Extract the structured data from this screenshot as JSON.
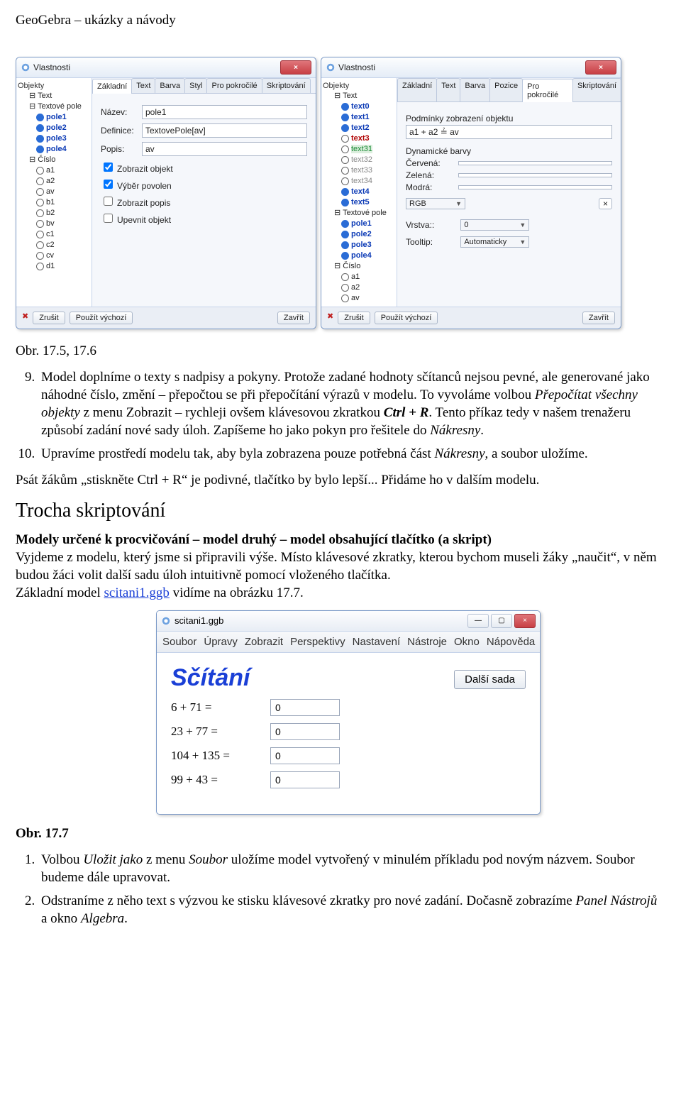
{
  "doc_header": "GeoGebra – ukázky a návody",
  "dlg_shared": {
    "title": "Vlastnosti",
    "close_x": "×",
    "tree_header": "Objekty",
    "bottom": {
      "cancel": "Zrušit",
      "defaults": "Použít výchozí",
      "close": "Zavřít"
    },
    "tabs": [
      "Základní",
      "Text",
      "Barva",
      "Styl",
      "Pro pokročilé",
      "Skriptování"
    ],
    "tabs2": [
      "Základní",
      "Text",
      "Barva",
      "Pozice",
      "Pro pokročilé",
      "Skriptování"
    ]
  },
  "dlg_left": {
    "tree": {
      "cat1": "Text",
      "cat2": "Textové pole",
      "cat2_items": [
        "pole1",
        "pole2",
        "pole3",
        "pole4"
      ],
      "cat3": "Číslo",
      "cat3_items": [
        "a1",
        "a2",
        "av",
        "b1",
        "b2",
        "bv",
        "c1",
        "c2",
        "cv",
        "d1"
      ]
    },
    "form": {
      "name_lbl": "Název:",
      "name_val": "pole1",
      "def_lbl": "Definice:",
      "def_val": "TextovePole[av]",
      "desc_lbl": "Popis:",
      "desc_val": "av",
      "chk_show": "Zobrazit objekt",
      "chk_sel": "Výběr povolen",
      "chk_lbl": "Zobrazit popis",
      "chk_fix": "Upevnit objekt"
    }
  },
  "dlg_right": {
    "tree": {
      "cat1": "Text",
      "cat1_items": [
        "text0",
        "text1",
        "text2",
        "text3",
        "text31",
        "text32",
        "text33",
        "text34",
        "text4",
        "text5"
      ],
      "cat2": "Textové pole",
      "cat2_items": [
        "pole1",
        "pole2",
        "pole3",
        "pole4"
      ],
      "cat3": "Číslo",
      "cat3_items": [
        "a1",
        "a2",
        "av"
      ]
    },
    "adv": {
      "cond_hd": "Podmínky zobrazení objektu",
      "cond_val": "a1 + a2 ≟ av",
      "dyncol_hd": "Dynamické barvy",
      "red": "Červená:",
      "green": "Zelená:",
      "blue": "Modrá:",
      "rgb": "RGB",
      "layer_lbl": "Vrstva::",
      "layer_val": "0",
      "tooltip_lbl": "Tooltip:",
      "tooltip_val": "Automaticky"
    }
  },
  "caption_figs": "Obr. 17.5, 17.6",
  "list1": {
    "item9_a": "Model doplníme o texty s nadpisy a pokyny. Protože zadané hodnoty sčítanců nejsou pevné, ale generované jako náhodné číslo, změní – přepočtou se při přepočítání výrazů v modelu. To vyvoláme volbou ",
    "item9_b": "Přepočítat všechny objekty",
    "item9_c": " z menu Zobrazit – rychleji ovšem klávesovou zkratkou ",
    "item9_d": "Ctrl + R",
    "item9_e": ". Tento příkaz tedy v našem trenažeru způsobí zadání nové sady úloh. Zapíšeme ho jako pokyn pro řešitele do ",
    "item9_f": "Nákresny",
    "item9_g": ".",
    "item10_a": "Upravíme prostředí modelu tak, aby byla zobrazena pouze potřebná část ",
    "item10_b": "Nákresny",
    "item10_c": ", a soubor uložíme."
  },
  "para_after": "Psát žákům „stiskněte Ctrl + R“ je podivné, tlačítko by bylo lepší... Přidáme ho v dalším modelu.",
  "section_title": "Trocha skriptování",
  "bold_para": "Modely určené k procvičování – model druhý – model obsahující tlačítko (a skript)",
  "para2_a": "Vyjdeme z modelu, který jsme si připravili výše. Místo klávesové zkratky, kterou bychom museli žáky „naučit“, v něm budou žáci volit další sadu úloh intuitivně pomocí vloženého tlačítka.",
  "para2_b1": "Základní model ",
  "para2_link": "scitani1.ggb",
  "para2_b2": " vidíme na obrázku 17.7.",
  "ggb": {
    "wintitle": "scitani1.ggb",
    "menu": [
      "Soubor",
      "Úpravy",
      "Zobrazit",
      "Perspektivy",
      "Nastavení",
      "Nástroje",
      "Okno",
      "Nápověda"
    ],
    "h1": "Sčítání",
    "btn": "Další sada",
    "rows": [
      {
        "expr": "6 + 71 =",
        "val": "0"
      },
      {
        "expr": "23 + 77 =",
        "val": "0"
      },
      {
        "expr": "104 + 135 =",
        "val": "0"
      },
      {
        "expr": "99 + 43 =",
        "val": "0"
      }
    ]
  },
  "caption_ggb": "Obr. 17.7",
  "list2": {
    "item1_a": "Volbou ",
    "item1_b": "Uložit jako",
    "item1_c": " z menu ",
    "item1_d": "Soubor",
    "item1_e": " uložíme model vytvořený v minulém příkladu pod novým názvem. Soubor budeme dále upravovat.",
    "item2_a": "Odstraníme z něho text s výzvou ke stisku klávesové zkratky pro nové zadání. Dočasně zobrazíme ",
    "item2_b": "Panel Nástrojů",
    "item2_c": " a okno ",
    "item2_d": "Algebra",
    "item2_e": "."
  }
}
